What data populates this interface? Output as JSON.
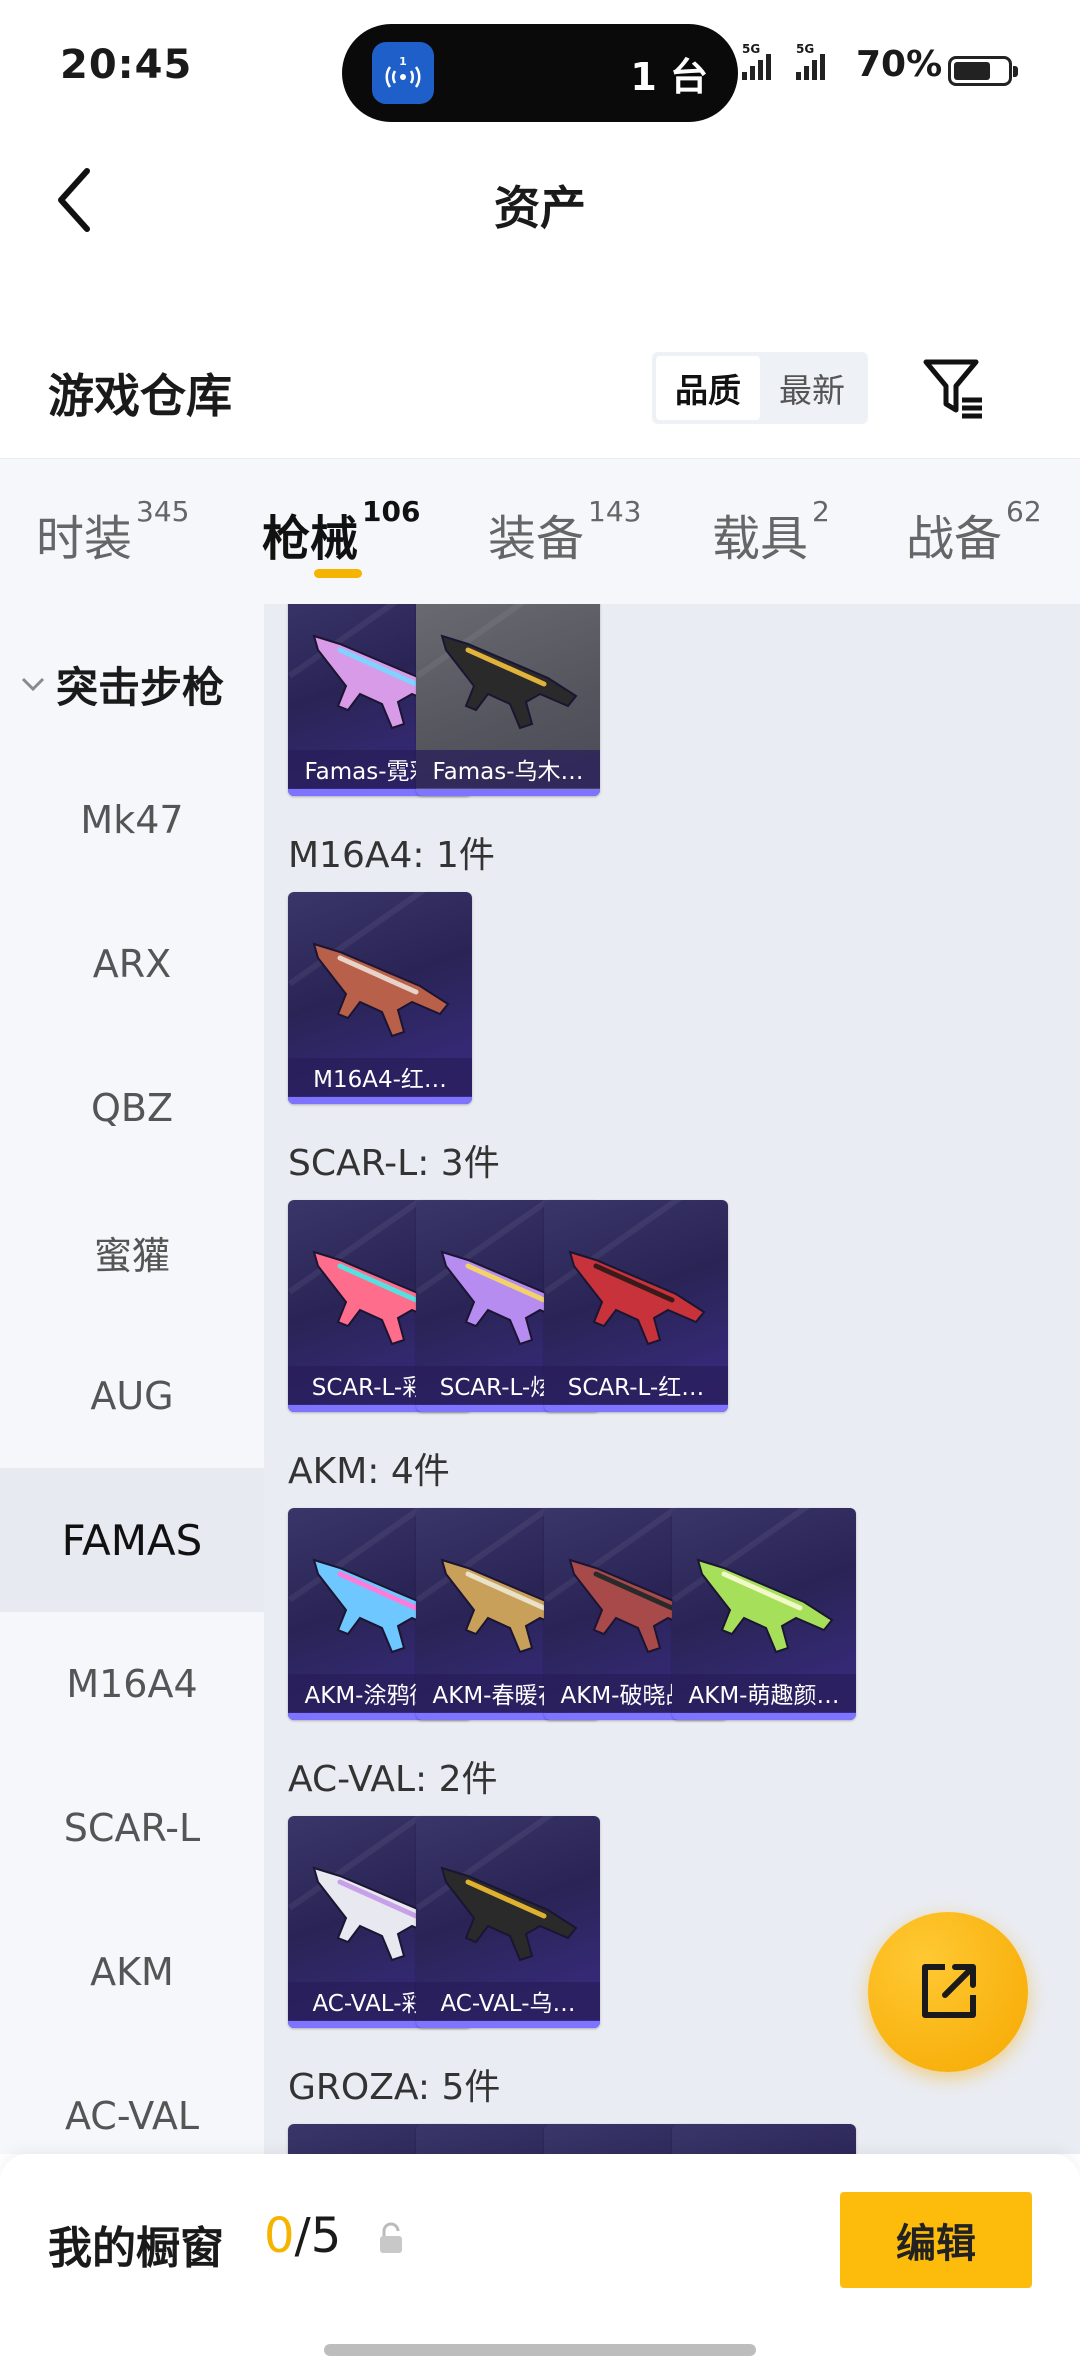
{
  "status_bar": {
    "time": "20:45",
    "island_count": "1 台",
    "hotspot_badge": "1",
    "network1": "5G",
    "network2": "5G",
    "battery": "70%",
    "battery_level": 0.7
  },
  "header": {
    "title": "资产"
  },
  "inventory": {
    "title": "游戏仓库",
    "sort_options": [
      "品质",
      "最新"
    ],
    "sort_selected": "品质"
  },
  "tabs": [
    {
      "label": "时装",
      "count": "345",
      "active": false
    },
    {
      "label": "枪械",
      "count": "106",
      "active": true
    },
    {
      "label": "装备",
      "count": "143",
      "active": false
    },
    {
      "label": "载具",
      "count": "2",
      "active": false
    },
    {
      "label": "战备",
      "count": "62",
      "active": false
    }
  ],
  "sidebar": {
    "category": "突击步枪",
    "items": [
      "Mk47",
      "ARX",
      "QBZ",
      "蜜獾",
      "AUG",
      "FAMAS",
      "M16A4",
      "SCAR-L",
      "AKM",
      "AC-VAL"
    ],
    "active": "FAMAS"
  },
  "groups": [
    {
      "label": "",
      "items": [
        {
          "name": "Famas-霓彩…",
          "color": "#d89be8",
          "accent": "#7fd3ff"
        },
        {
          "name": "Famas-乌木…",
          "color": "#2a2a2a",
          "accent": "#e2b33c"
        }
      ]
    },
    {
      "label": "M16A4: 1件",
      "items": [
        {
          "name": "M16A4-红…",
          "color": "#b8604a",
          "accent": "#e7d3c8"
        }
      ]
    },
    {
      "label": "SCAR-L: 3件",
      "items": [
        {
          "name": "SCAR-L-彩…",
          "color": "#ff6d8d",
          "accent": "#58e0e0"
        },
        {
          "name": "SCAR-L-炫…",
          "color": "#b68cf0",
          "accent": "#f2d36a"
        },
        {
          "name": "SCAR-L-红…",
          "color": "#c8323a",
          "accent": "#3a1a1a"
        }
      ]
    },
    {
      "label": "AKM: 4件",
      "items": [
        {
          "name": "AKM-涂鸦街区",
          "color": "#6ec8ff",
          "accent": "#ff7ad9"
        },
        {
          "name": "AKM-春暖花开",
          "color": "#c9a05a",
          "accent": "#e9e1c8"
        },
        {
          "name": "AKM-破晓战魂",
          "color": "#a84a4a",
          "accent": "#2a2a2a"
        },
        {
          "name": "AKM-萌趣颜…",
          "color": "#a6e05a",
          "accent": "#f2f9c8"
        }
      ]
    },
    {
      "label": "AC-VAL: 2件",
      "items": [
        {
          "name": "AC-VAL-彩…",
          "color": "#e8e8f0",
          "accent": "#c8a0e8"
        },
        {
          "name": "AC-VAL-乌…",
          "color": "#2a2a2a",
          "accent": "#e0b030"
        }
      ]
    },
    {
      "label": "GROZA: 5件",
      "items": []
    }
  ],
  "bottom": {
    "showcase_label": "我的橱窗",
    "showcase_current": "0",
    "showcase_max": "/5",
    "edit_label": "编辑"
  },
  "colors": {
    "accent": "#f5b400",
    "card_bg": "#2a2456",
    "card_bar": "#7f74ff"
  }
}
